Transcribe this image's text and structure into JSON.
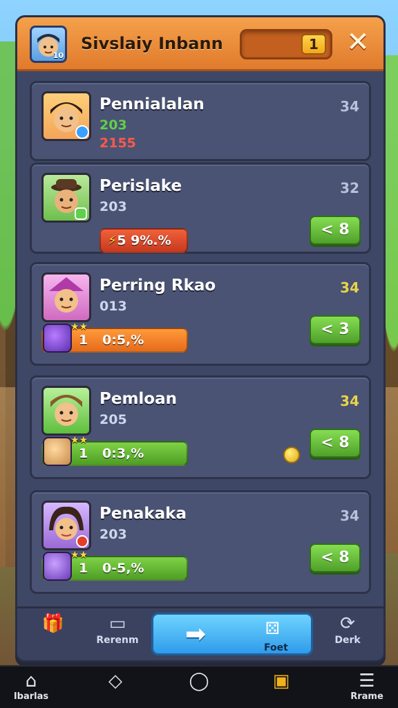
{
  "header": {
    "title": "Sivslaiy Inbann",
    "avatar_level": "10",
    "count": "1",
    "close_glyph": "✕"
  },
  "players": [
    {
      "name": "Pennialalan",
      "score": "203",
      "rank": "34",
      "bar_text": "2155",
      "bar_style": "red",
      "face_color": "#f3a55a",
      "show_go": false
    },
    {
      "name": "Perislake",
      "score": "203",
      "rank": "32",
      "bar_text": "5 9%.%",
      "bar_style": "red",
      "face_color": "#9ad07a",
      "show_go": true,
      "go_label": "< 8"
    },
    {
      "name": "Perring Rkao",
      "score": "013",
      "rank": "34",
      "bar_one": "1",
      "bar_text": "0:5,%",
      "bar_style": "orange",
      "face_color": "#e58bd6",
      "show_go": true,
      "go_label": "< 3"
    },
    {
      "name": "Pemloan",
      "score": "205",
      "rank": "34",
      "bar_one": "1",
      "bar_text": "0:3,%",
      "bar_style": "green",
      "face_color": "#8ee07a",
      "show_go": true,
      "go_label": "< 8"
    },
    {
      "name": "Penakaka",
      "score": "203",
      "rank": "34",
      "bar_one": "1",
      "bar_text": "0-5,%",
      "bar_style": "green",
      "face_color": "#c79ae0",
      "show_go": true,
      "go_label": "< 8"
    }
  ],
  "actions": {
    "left_label": "",
    "rename_label": "Rerenm",
    "primary_label": "Foet",
    "dark_label": "Derk"
  },
  "nav": [
    {
      "label": "Ibarlas",
      "icon": "home-icon"
    },
    {
      "label": "",
      "icon": "tag-icon"
    },
    {
      "label": "",
      "icon": "shield-icon"
    },
    {
      "label": "",
      "icon": "chart-icon"
    },
    {
      "label": "Rrame",
      "icon": "menu-icon"
    }
  ],
  "colors": {
    "header_orange": "#e07b2c",
    "panel": "#3f4766",
    "go_green": "#4fa02a",
    "primary_blue": "#2f9bea"
  }
}
